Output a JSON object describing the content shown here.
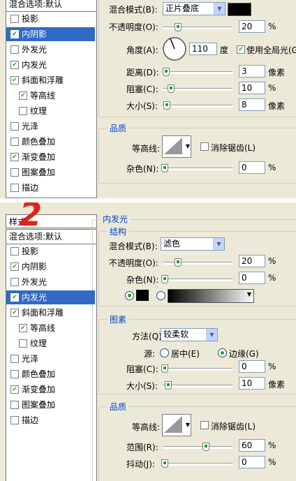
{
  "top": {
    "sidebar": {
      "header": "混合选项:默认",
      "items": [
        {
          "label": "投影",
          "checked": false
        },
        {
          "label": "内阴影",
          "checked": true,
          "selected": true
        },
        {
          "label": "外发光",
          "checked": false
        },
        {
          "label": "内发光",
          "checked": true
        },
        {
          "label": "斜面和浮雕",
          "checked": true
        },
        {
          "label": "等高线",
          "checked": true
        },
        {
          "label": "纹理",
          "checked": false
        },
        {
          "label": "光泽",
          "checked": false
        },
        {
          "label": "颜色叠加",
          "checked": false
        },
        {
          "label": "渐变叠加",
          "checked": true
        },
        {
          "label": "图案叠加",
          "checked": false
        },
        {
          "label": "描边",
          "checked": false
        }
      ]
    },
    "blend_mode_label": "混合模式(B):",
    "blend_mode_value": "正片叠底",
    "opacity_label": "不透明度(O):",
    "opacity_value": "20",
    "percent": "%",
    "angle_label": "角度(A):",
    "angle_value": "110",
    "degree": "度",
    "global_light_label": "使用全局光(G)",
    "distance_label": "距离(D):",
    "distance_value": "3",
    "choke_label": "阻塞(C):",
    "choke_value": "10",
    "size_label": "大小(S):",
    "size_value": "8",
    "px": "像素",
    "quality_legend": "品质",
    "contour_label": "等高线:",
    "antialias_label": "消除锯齿(L)",
    "noise_label": "杂色(N):",
    "noise_value": "0"
  },
  "bottom": {
    "badge": "2",
    "styles_header": "样式",
    "sidebar": {
      "header": "混合选项:默认",
      "items": [
        {
          "label": "投影",
          "checked": false
        },
        {
          "label": "内阴影",
          "checked": true
        },
        {
          "label": "外发光",
          "checked": false
        },
        {
          "label": "内发光",
          "checked": true,
          "selected": true
        },
        {
          "label": "斜面和浮雕",
          "checked": true
        },
        {
          "label": "等高线",
          "checked": true
        },
        {
          "label": "纹理",
          "checked": false
        },
        {
          "label": "光泽",
          "checked": false
        },
        {
          "label": "颜色叠加",
          "checked": false
        },
        {
          "label": "渐变叠加",
          "checked": true
        },
        {
          "label": "图案叠加",
          "checked": false
        },
        {
          "label": "描边",
          "checked": false
        }
      ]
    },
    "section_title": "内发光",
    "structure_legend": "结构",
    "blend_mode_label": "混合模式(B):",
    "blend_mode_value": "滤色",
    "opacity_label": "不透明度(O):",
    "opacity_value": "20",
    "noise_label": "杂色(N):",
    "noise_value": "0",
    "percent": "%",
    "elements_legend": "图素",
    "technique_label": "方法(Q):",
    "technique_value": "较柔软",
    "source_label": "源:",
    "source_center": "居中(E)",
    "source_edge": "边缘(G)",
    "choke_label": "阻塞(C):",
    "choke_value": "0",
    "size_label": "大小(S):",
    "size_value": "10",
    "px": "像素",
    "quality_legend": "品质",
    "contour_label": "等高线:",
    "antialias_label": "消除锯齿(L)",
    "range_label": "范围(R):",
    "range_value": "60",
    "jitter_label": "抖动(J):",
    "jitter_value": "0"
  },
  "colors": {
    "accent": "#316ac5",
    "check": "#21a121",
    "legend": "#0046d5",
    "badge": "#e0221a"
  }
}
